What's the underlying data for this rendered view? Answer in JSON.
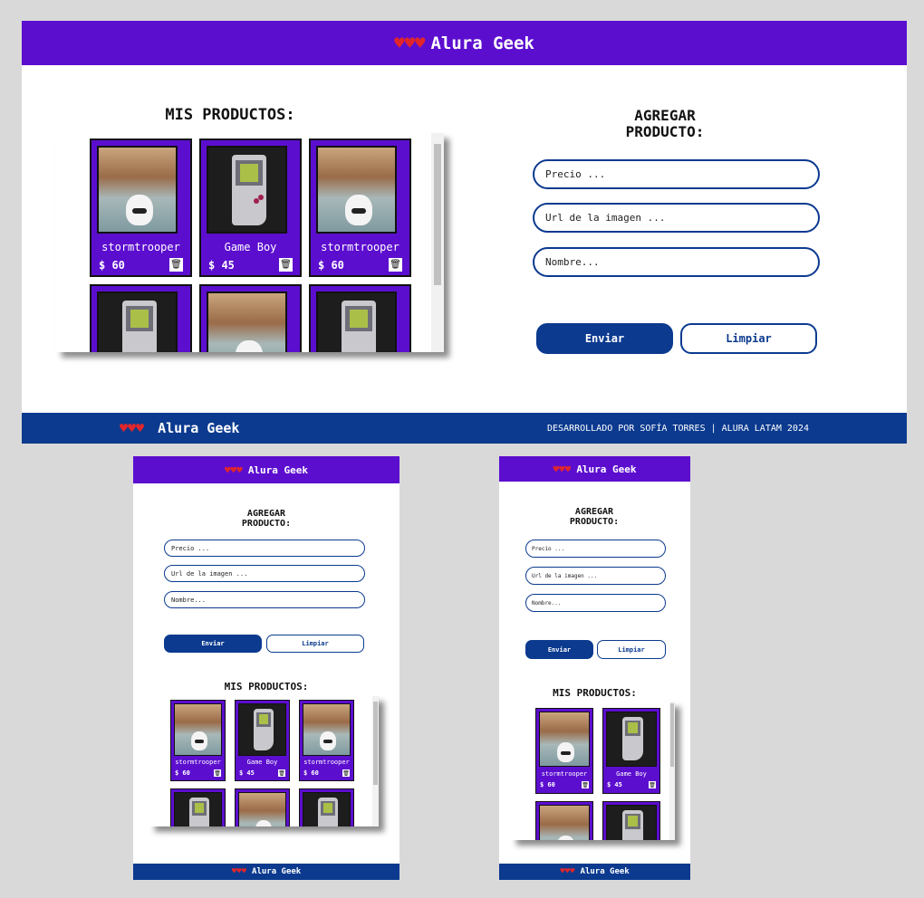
{
  "brand": {
    "hearts": "♥♥♥",
    "name": "Alura Geek"
  },
  "products_section": {
    "title": "MIS PRODUCTOS:"
  },
  "form": {
    "title_line1": "AGREGAR",
    "title_line2": "PRODUCTO:",
    "price_placeholder": "Precio ...",
    "url_placeholder": "Url de la imagen ...",
    "name_placeholder": "Nombre...",
    "send_label": "Enviar",
    "clear_label": "Limpiar"
  },
  "footer": {
    "credits": "DESARROLLADO POR SOFÍA TORRES | ALURA LATAM 2024"
  },
  "products": [
    {
      "name": "stormtrooper",
      "price": "$ 60",
      "image": "stormtrooper"
    },
    {
      "name": "Game Boy",
      "price": "$ 45",
      "image": "gameboy"
    },
    {
      "name": "stormtrooper",
      "price": "$ 60",
      "image": "stormtrooper"
    },
    {
      "name": "",
      "price": "",
      "image": "gameboy"
    },
    {
      "name": "",
      "price": "",
      "image": "stormtrooper"
    },
    {
      "name": "",
      "price": "",
      "image": "gameboy"
    }
  ],
  "icons": {
    "heart": "heart-icon",
    "trash": "trash-icon"
  },
  "colors": {
    "header": "#5c0ecf",
    "footer": "#0b3a8f",
    "accent": "#0b3a8f",
    "background": "#d9d9d9"
  }
}
